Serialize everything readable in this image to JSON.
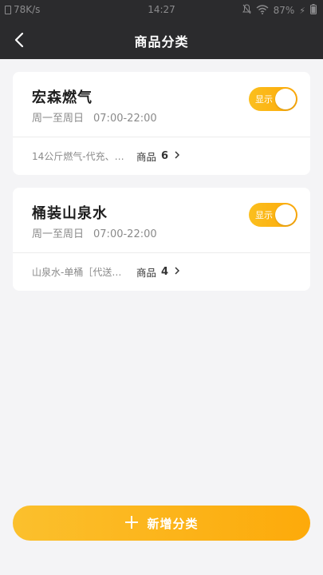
{
  "status_bar": {
    "net_speed": "78K/s",
    "time": "14:27",
    "battery": "87%"
  },
  "header": {
    "title": "商品分类"
  },
  "categories": [
    {
      "name": "宏森燃气",
      "days": "周一至周日",
      "hours": "07:00-22:00",
      "toggle_label": "显示",
      "items_preview": "14公斤燃气-代充、…",
      "goods_label": "商品",
      "goods_count": "6"
    },
    {
      "name": "桶装山泉水",
      "days": "周一至周日",
      "hours": "07:00-22:00",
      "toggle_label": "显示",
      "items_preview": "山泉水-单桶［代送…",
      "goods_label": "商品",
      "goods_count": "4"
    }
  ],
  "add_button": {
    "label": "新增分类"
  },
  "colors": {
    "header_bg": "#2b2b2d",
    "accent": "#fcb316",
    "background": "#f4f4f6"
  }
}
